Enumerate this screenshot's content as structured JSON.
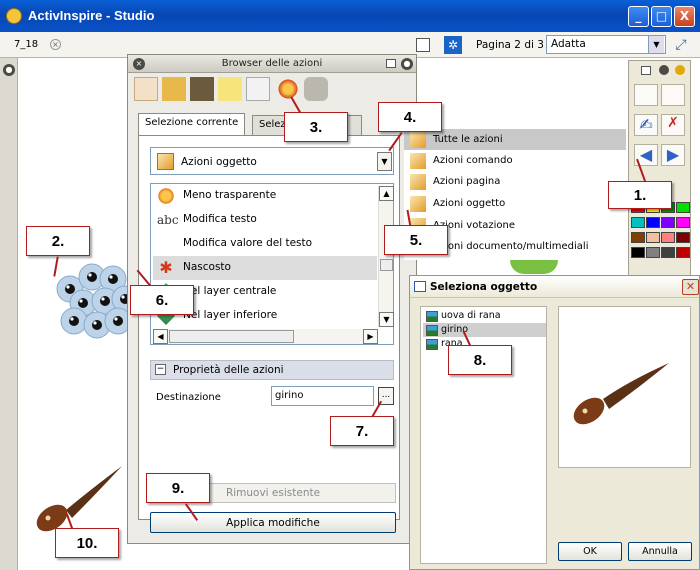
{
  "window": {
    "title": "ActivInspire - Studio",
    "minimize": "_",
    "maximize": "□",
    "close": "X"
  },
  "toolbar": {
    "tab_name": "7_18",
    "page_info": "Pagina 2 di 3",
    "fit_value": "Adatta"
  },
  "browser": {
    "title": "Browser delle azioni",
    "tabs": [
      "Selezione corrente",
      "Seleziona azione"
    ],
    "action_type": "Azioni oggetto",
    "actions": [
      "Meno trasparente",
      "Modifica testo",
      "Modifica valore del testo",
      "Nascosto",
      "Nel layer centrale",
      "Nel layer inferiore"
    ],
    "selected_action": "Nascosto",
    "properties_header": "Proprietà delle azioni",
    "destination_label": "Destinazione",
    "destination_value": "girino",
    "ellipsis": "...",
    "remove_label": "Rimuovi esistente",
    "apply_label": "Applica modifiche"
  },
  "action_types": [
    "Tutte le azioni",
    "Azioni comando",
    "Azioni pagina",
    "Azioni oggetto",
    "Azioni votazione",
    "Azioni documento/multimediali"
  ],
  "select_dialog": {
    "title": "Seleziona oggetto",
    "items": [
      "uova di rana",
      "girino",
      "rana"
    ],
    "selected": "girino",
    "ok": "OK",
    "cancel": "Annulla"
  },
  "callouts": [
    "1.",
    "2.",
    "3.",
    "4.",
    "5.",
    "6.",
    "7.",
    "8.",
    "9.",
    "10."
  ],
  "colors": {
    "title_bar": "#0747b3",
    "callout_border": "#b01c1c",
    "tadpole": "#7b3b16"
  },
  "palette_colors": [
    "#ff0000",
    "#ffff00",
    "#00a000",
    "#00e000",
    "#00c0c0",
    "#0000ff",
    "#8000ff",
    "#ff00ff",
    "#804000",
    "#f0c0a0",
    "#ff8080",
    "#800000",
    "#000000",
    "#808080",
    "#404040",
    "#c00000"
  ]
}
